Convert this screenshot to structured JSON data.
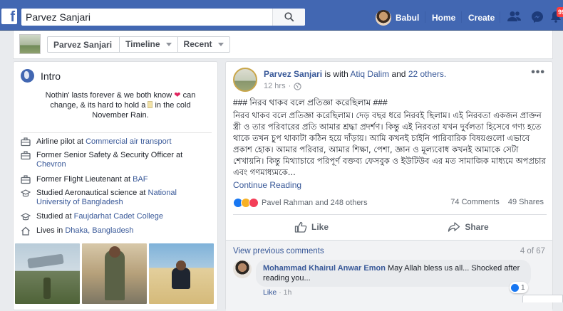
{
  "topbar": {
    "logo": "f",
    "search_value": "Parvez Sanjari",
    "user_name": "Babul",
    "home_label": "Home",
    "create_label": "Create",
    "notification_count": "99",
    "colors": {
      "bar": "#4267b2",
      "badge": "#fa3e3e"
    }
  },
  "profile_strip": {
    "name": "Parvez Sanjari",
    "timeline_label": "Timeline",
    "recent_label": "Recent"
  },
  "intro": {
    "title": "Intro",
    "bio_part1": "Nothin' lasts forever & we both know",
    "bio_part2": "can change, & its hard to hold a",
    "bio_part3": "in the cold November Rain.",
    "items": [
      {
        "icon": "briefcase-icon",
        "text": "Airline pilot at ",
        "link": "Commercial air transport"
      },
      {
        "icon": "briefcase-icon",
        "text": "Former Senior Safety & Security Officer at ",
        "link": "Chevron"
      },
      {
        "icon": "briefcase-icon",
        "text": "Former Flight Lieutenant at ",
        "link": "BAF"
      },
      {
        "icon": "graduation-cap-icon",
        "text": "Studied Aeronautical science at ",
        "link": "National University of Bangladesh"
      },
      {
        "icon": "graduation-cap-icon",
        "text": "Studied at ",
        "link": "Faujdarhat Cadet College"
      },
      {
        "icon": "home-icon",
        "text": "Lives in ",
        "link": "Dhaka, Bangladesh"
      }
    ]
  },
  "post": {
    "author": "Parvez Sanjari",
    "with_text": "is with",
    "tagged": "Atiq Dalim",
    "and_text": "and",
    "others": "22 others.",
    "time": "12 hrs",
    "dot": "·",
    "headline": "### নিরব থাকব বলে প্রতিজ্ঞা করেছিলাম ###",
    "body": "নিরব থাকব বলে প্রতিজ্ঞা করেছিলাম। দেড় বছর ধরে নিরবই ছিলাম। এই নিরবতা একজন প্রাক্তন স্ত্রী ও তার পরিবারের প্রতি আমার শ্রদ্ধা প্রদর্শণ। কিন্তু এই নিরবতা যখন দুর্বলতা হিসেবে গণ্য হতে থাকে তখন চুপ থাকাটা কঠিন হয়ে দাঁড়ায়। আমি কখনই চাইনি পারিবারিক বিষয়গুলো এভাবে প্রকাশ হোক। আমার পরিবার, আমার শিক্ষা, পেশা, জ্ঞান ও মূল্যবোধ কখনই আমাকে সেটা শেখায়নি। কিন্তু মিথ্যাচারে পরিপূর্ণ বক্তব্য ফেসবুক ও ইউটিউব এর মত সামাজিক মাধ্যমে অপপ্রচার এবং গণমাধ্যমকে...",
    "continue_label": "Continue Reading",
    "reactions_text": "Pavel Rahman and 248 others",
    "comments_count": "74 Comments",
    "shares_count": "49 Shares",
    "like_label": "Like",
    "share_label": "Share",
    "view_previous": "View previous comments",
    "comment_position": "4 of 67",
    "comment": {
      "author": "Mohammad Khairul Anwar Emon",
      "text": "May Allah bless us all... Shocked after reading you...",
      "like_label": "Like",
      "dot": "·",
      "time": "1h",
      "reaction_count": "1"
    }
  }
}
